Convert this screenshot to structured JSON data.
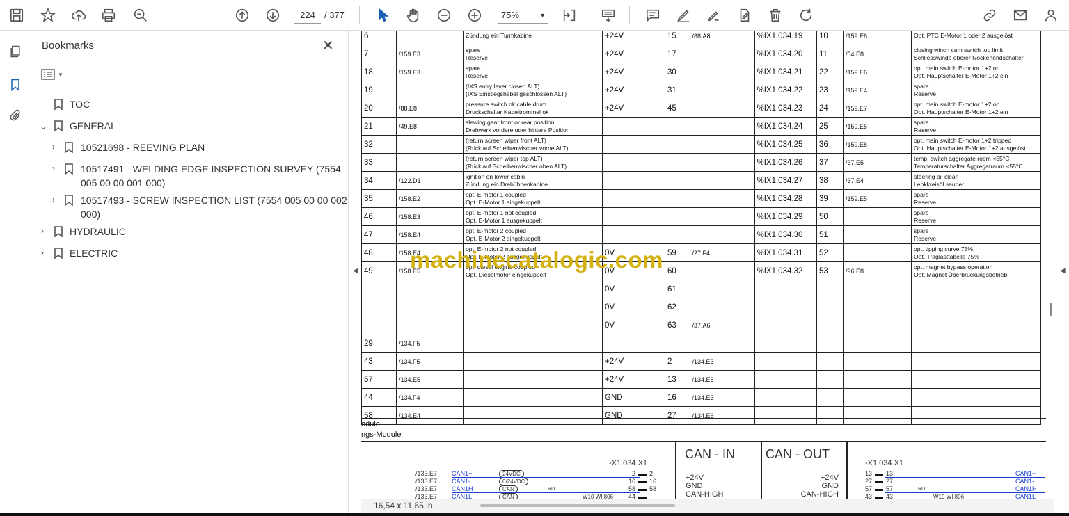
{
  "toolbar": {
    "page_current": "224",
    "page_total": "/ 377",
    "zoom": "75%"
  },
  "panel": {
    "title": "Bookmarks",
    "close": "✕"
  },
  "bookmarks": [
    {
      "label": "TOC"
    },
    {
      "label": "GENERAL"
    },
    {
      "label": "10521698 - REEVING PLAN"
    },
    {
      "label": "10517491 - WELDING EDGE INSPECTION SURVEY (7554"
    },
    {
      "label": "005 00 00 001 000)"
    },
    {
      "label": "10517493 - SCREW INSPECTION LIST (7554 005 00 00 002"
    },
    {
      "label": "000)"
    },
    {
      "label": "HYDRAULIC"
    },
    {
      "label": "ELECTRIC"
    }
  ],
  "rows": [
    {
      "a": "6",
      "b": "",
      "d1": "",
      "d2": "Zündung ein Turmkabine",
      "v": "+24V",
      "p": "15",
      "r": "/88.A8",
      "io": "%IX1.034.19",
      "n": "10",
      "ref": "/159.E6",
      "e1": "",
      "e2": "Opt. PTC E-Motor 1 oder 2 ausgelöst"
    },
    {
      "a": "7",
      "b": "/159.E3",
      "d1": "spare",
      "d2": "Reserve",
      "v": "+24V",
      "p": "17",
      "r": "",
      "io": "%IX1.034.20",
      "n": "11",
      "ref": "/54.E8",
      "e1": "closing winch cam switch top limit",
      "e2": "Schliesswinde oberer Nockenendschalter"
    },
    {
      "a": "18",
      "b": "/159.E3",
      "d1": "spare",
      "d2": "Reserve",
      "v": "+24V",
      "p": "30",
      "r": "",
      "io": "%IX1.034.21",
      "n": "22",
      "ref": "/159.E6",
      "e1": "opt. main switch E-motor 1+2 on",
      "e2": "Opt. Hauptschalter E-Motor 1+2 ein"
    },
    {
      "a": "19",
      "b": "",
      "d1": "(IXS entry lever closed ALT)",
      "d2": "(IXS Einstiegshebel geschlossen ALT)",
      "v": "+24V",
      "p": "31",
      "r": "",
      "io": "%IX1.034.22",
      "n": "23",
      "ref": "/159.E4",
      "e1": "spare",
      "e2": "Reserve"
    },
    {
      "a": "20",
      "b": "/88.E8",
      "d1": "pressure switch ok cable drum",
      "d2": "Druckschalter Kabeltrommel ok",
      "v": "+24V",
      "p": "45",
      "r": "",
      "io": "%IX1.034.23",
      "n": "24",
      "ref": "/159.E7",
      "e1": "opt. main switch E-motor 1+2 on",
      "e2": "Opt. Hauptschalter E-Motor 1+2 ein"
    },
    {
      "a": "21",
      "b": "/49.E8",
      "d1": "slewing gear front or rear position",
      "d2": "Drehwerk vordere oder hintere Position",
      "v": "",
      "p": "",
      "r": "",
      "io": "%IX1.034.24",
      "n": "25",
      "ref": "/159.E5",
      "e1": "spare",
      "e2": "Reserve"
    },
    {
      "a": "32",
      "b": "",
      "d1": "(return screen wiper front ALT)",
      "d2": "(Rücklauf Scheibenwischer vorne ALT)",
      "v": "",
      "p": "",
      "r": "",
      "io": "%IX1.034.25",
      "n": "36",
      "ref": "/159.E8",
      "e1": "opt. main switch E-motor 1+2 tripped",
      "e2": "Opt. Hauptschalter E-Motor 1+2 ausgelöst"
    },
    {
      "a": "33",
      "b": "",
      "d1": "(return screen wiper top ALT)",
      "d2": "(Rücklauf Scheibenwischer oben ALT)",
      "v": "",
      "p": "",
      "r": "",
      "io": "%IX1.034.26",
      "n": "37",
      "ref": "/37.E5",
      "e1": "temp. switch aggregate room <55°C",
      "e2": "Temperaturschalter Aggregatraum <55°C"
    },
    {
      "a": "34",
      "b": "/122.D1",
      "d1": "ignition on lower cabin",
      "d2": "Zündung ein Drebühnenkabine",
      "v": "",
      "p": "",
      "r": "",
      "io": "%IX1.034.27",
      "n": "38",
      "ref": "/37.E4",
      "e1": "steering oil clean",
      "e2": "Lenkkreisöl sauber"
    },
    {
      "a": "35",
      "b": "/158.E2",
      "d1": "opt. E-motor 1 coupled",
      "d2": "Opt. E-Motor 1 eingekuppelt",
      "v": "",
      "p": "",
      "r": "",
      "io": "%IX1.034.28",
      "n": "39",
      "ref": "/159.E5",
      "e1": "spare",
      "e2": "Reserve"
    },
    {
      "a": "46",
      "b": "/158.E3",
      "d1": "opt. E-motor 1 not coupled",
      "d2": "Opt. E-Motor 1 ausgekuppelt",
      "v": "",
      "p": "",
      "r": "",
      "io": "%IX1.034.29",
      "n": "50",
      "ref": "",
      "e1": "spare",
      "e2": "Reserve"
    },
    {
      "a": "47",
      "b": "/158.E4",
      "d1": "opt. E-motor 2 coupled",
      "d2": "Opt. E-Motor 2 eingekuppelt",
      "v": "",
      "p": "",
      "r": "",
      "io": "%IX1.034.30",
      "n": "51",
      "ref": "",
      "e1": "spare",
      "e2": "Reserve"
    },
    {
      "a": "48",
      "b": "/158.E4",
      "d1": "opt. E-motor 2 not coupled",
      "d2": "Opt. E-Motor 2 ausgekuppelt",
      "v": "0V",
      "p": "59",
      "r": "/27.F4",
      "io": "%IX1.034.31",
      "n": "52",
      "ref": "",
      "e1": "opt. tipping curve 75%",
      "e2": "Opt. Traglasttabelle 75%"
    },
    {
      "a": "49",
      "b": "/158.E5",
      "d1": "opt. diesel engine coupled",
      "d2": "Opt. Dieselmotor eingekuppelt",
      "v": "0V",
      "p": "60",
      "r": "",
      "io": "%IX1.034.32",
      "n": "53",
      "ref": "/96.E8",
      "e1": "opt. magnet bypass operation",
      "e2": "Opt. Magnet Überbrückungsbetrieb"
    },
    {
      "a": "",
      "b": "",
      "d1": "",
      "d2": "",
      "v": "0V",
      "p": "61",
      "r": "",
      "io": "",
      "n": "",
      "ref": "",
      "e1": "",
      "e2": ""
    },
    {
      "a": "",
      "b": "",
      "d1": "",
      "d2": "",
      "v": "0V",
      "p": "62",
      "r": "",
      "io": "",
      "n": "",
      "ref": "",
      "e1": "",
      "e2": ""
    },
    {
      "a": "",
      "b": "",
      "d1": "",
      "d2": "",
      "v": "0V",
      "p": "63",
      "r": "/37.A6",
      "io": "",
      "n": "",
      "ref": "",
      "e1": "",
      "e2": ""
    },
    {
      "a": "29",
      "b": "/134.F5",
      "d1": "",
      "d2": "",
      "v": "",
      "p": "",
      "r": "",
      "io": "",
      "n": "",
      "ref": "",
      "e1": "",
      "e2": ""
    },
    {
      "a": "43",
      "b": "/134.F5",
      "d1": "",
      "d2": "",
      "v": "+24V",
      "p": "2",
      "r": "/134.E3",
      "io": "",
      "n": "",
      "ref": "",
      "e1": "",
      "e2": ""
    },
    {
      "a": "57",
      "b": "/134.E5",
      "d1": "",
      "d2": "",
      "v": "+24V",
      "p": "13",
      "r": "/134.E6",
      "io": "",
      "n": "",
      "ref": "",
      "e1": "",
      "e2": ""
    },
    {
      "a": "44",
      "b": "/134.F4",
      "d1": "",
      "d2": "",
      "v": "GND",
      "p": "16",
      "r": "/134.E3",
      "io": "",
      "n": "",
      "ref": "",
      "e1": "",
      "e2": ""
    },
    {
      "a": "58",
      "b": "/134.E4",
      "d1": "",
      "d2": "",
      "v": "GND",
      "p": "27",
      "r": "/134.E6",
      "io": "",
      "n": "",
      "ref": "",
      "e1": "",
      "e2": ""
    }
  ],
  "module": {
    "line1": "odule",
    "line2": "ngs-Module"
  },
  "lower": {
    "x_left": "-X1.034.X1",
    "x_right": "-X1.034.X1",
    "can_in": "CAN - IN",
    "can_out": "CAN - OUT",
    "in_signals": [
      "+24V",
      "GND",
      "CAN-HIGH"
    ],
    "out_signals": [
      "+24V",
      "GND",
      "CAN-HIGH"
    ],
    "refs": [
      "/133.E7",
      "/133.E7",
      "/133.E7",
      "/133.E7"
    ],
    "cans": [
      "CAN1+",
      "CAN1-",
      "CAN1H",
      "CAN1L"
    ],
    "tags": [
      "24VDC",
      "0/24VDC",
      "CAN",
      "CAN"
    ],
    "pins_l": [
      "2",
      "16",
      "58",
      "44"
    ],
    "pins_l2": [
      "2",
      "16",
      "58"
    ],
    "pins_r": [
      "13",
      "27",
      "57",
      "43"
    ],
    "pins_r2": [
      "13",
      "27",
      "57",
      "43"
    ],
    "cans_r": [
      "CAN1+",
      "CAN1-",
      "CAN1H",
      "CAN1L"
    ],
    "wire": "W10 WI 806",
    "rd": "RD"
  },
  "watermark": "machinecatalogic.com",
  "status": {
    "size": "16,54 x 11,65 in"
  }
}
